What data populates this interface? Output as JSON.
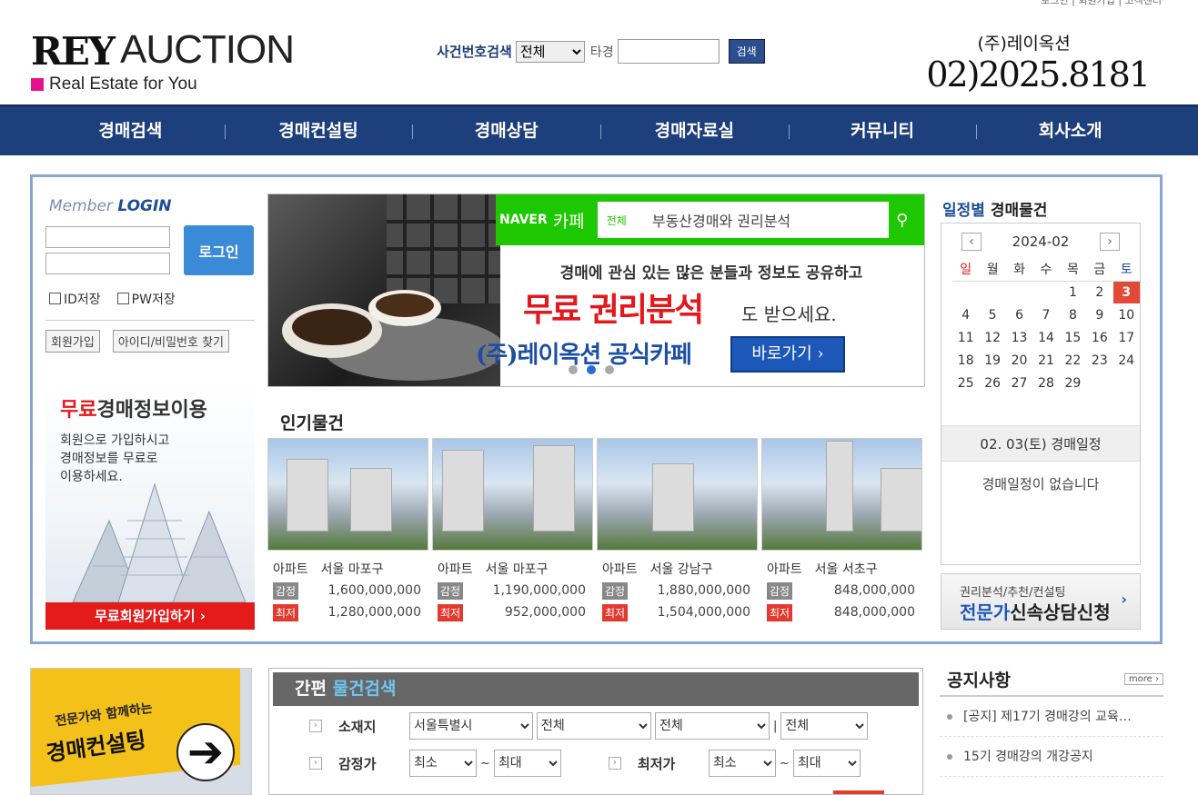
{
  "header": {
    "top_util_text": "로그인 | 회원가입 | 고객센터",
    "logo_main": "REY",
    "logo_sub": "AUCTION",
    "logo_tagline": "Real Estate for You",
    "case_search_label": "사건번호검색",
    "case_search_select": "전체",
    "case_search_ta": "타경",
    "case_search_button": "검색",
    "company": "(주)레이옥션",
    "phone": "02)2025.8181"
  },
  "nav": [
    "경매검색",
    "경매컨설팅",
    "경매상담",
    "경매자료실",
    "커뮤니티",
    "회사소개"
  ],
  "login": {
    "title_member": "Member",
    "title_login": "LOGIN",
    "login_button": "로그인",
    "save_id": "ID저장",
    "save_pw": "PW저장",
    "join": "회원가입",
    "find": "아이디/비밀번호 찾기"
  },
  "promo": {
    "heading_red": "무료",
    "heading_rest": "경매정보이용",
    "line1": "회원으로 가입하시고",
    "line2": "경매정보를 무료로",
    "line3": "이용하세요.",
    "button": "무료회원가입하기 ›"
  },
  "banner": {
    "naver": "NAVER",
    "cafe": "카페",
    "search_scope": "전체",
    "search_text": "부동산경매와 권리분석",
    "line1": "경매에 관심 있는 많은 분들과 정보도 공유하고",
    "line2": "무료 권리분석",
    "line2_suffix": "도 받으세요.",
    "line3": "(주)레이옥션 공식카페",
    "shortcut": "바로가기 ›"
  },
  "popular": {
    "title": "인기물건",
    "label_appraisal": "감정",
    "label_minimum": "최저",
    "items": [
      {
        "type": "아파트",
        "location": "서울 마포구",
        "appraisal": "1,600,000,000",
        "minimum": "1,280,000,000"
      },
      {
        "type": "아파트",
        "location": "서울 마포구",
        "appraisal": "1,190,000,000",
        "minimum": "952,000,000"
      },
      {
        "type": "아파트",
        "location": "서울 강남구",
        "appraisal": "1,880,000,000",
        "minimum": "1,504,000,000"
      },
      {
        "type": "아파트",
        "location": "서울 서초구",
        "appraisal": "848,000,000",
        "minimum": "848,000,000"
      }
    ]
  },
  "calendar": {
    "title_em": "일정별",
    "title_rest": "경매물건",
    "month": "2024-02",
    "prev": "‹",
    "next": "›",
    "weekdays": [
      "일",
      "월",
      "화",
      "수",
      "목",
      "금",
      "토"
    ],
    "weeks": [
      [
        "",
        "",
        "",
        "",
        "1",
        "2",
        "3"
      ],
      [
        "4",
        "5",
        "6",
        "7",
        "8",
        "9",
        "10"
      ],
      [
        "11",
        "12",
        "13",
        "14",
        "15",
        "16",
        "17"
      ],
      [
        "18",
        "19",
        "20",
        "21",
        "22",
        "23",
        "24"
      ],
      [
        "25",
        "26",
        "27",
        "28",
        "29",
        "",
        ""
      ]
    ],
    "today": "3",
    "schedule_title": "02. 03(토) 경매일정",
    "schedule_empty": "경매일정이 없습니다"
  },
  "consult": {
    "small": "권리분석/추천/컨설팅",
    "big_em": "전문가",
    "big_rest": "신속상담신청",
    "arrow": "›"
  },
  "consulting_banner": {
    "line1": "전문가와 함께하는",
    "line2": "경매컨설팅",
    "arrow": "➔"
  },
  "quick_search": {
    "title": "간편",
    "title_em": "물건검색",
    "location_label": "소재지",
    "location_values": [
      "서울특별시",
      "전체",
      "전체",
      "전체"
    ],
    "appraisal_label": "감정가",
    "appraisal_min": "최소",
    "appraisal_max": "최대",
    "minimum_label": "최저가",
    "minimum_min": "최소",
    "minimum_max": "최대",
    "tilde": "~",
    "separator": "|"
  },
  "notice": {
    "title": "공지사항",
    "more": "more ›",
    "items": [
      "[공지] 제17기 경매강의 교육…",
      "15기 경매강의 개강공지"
    ]
  }
}
